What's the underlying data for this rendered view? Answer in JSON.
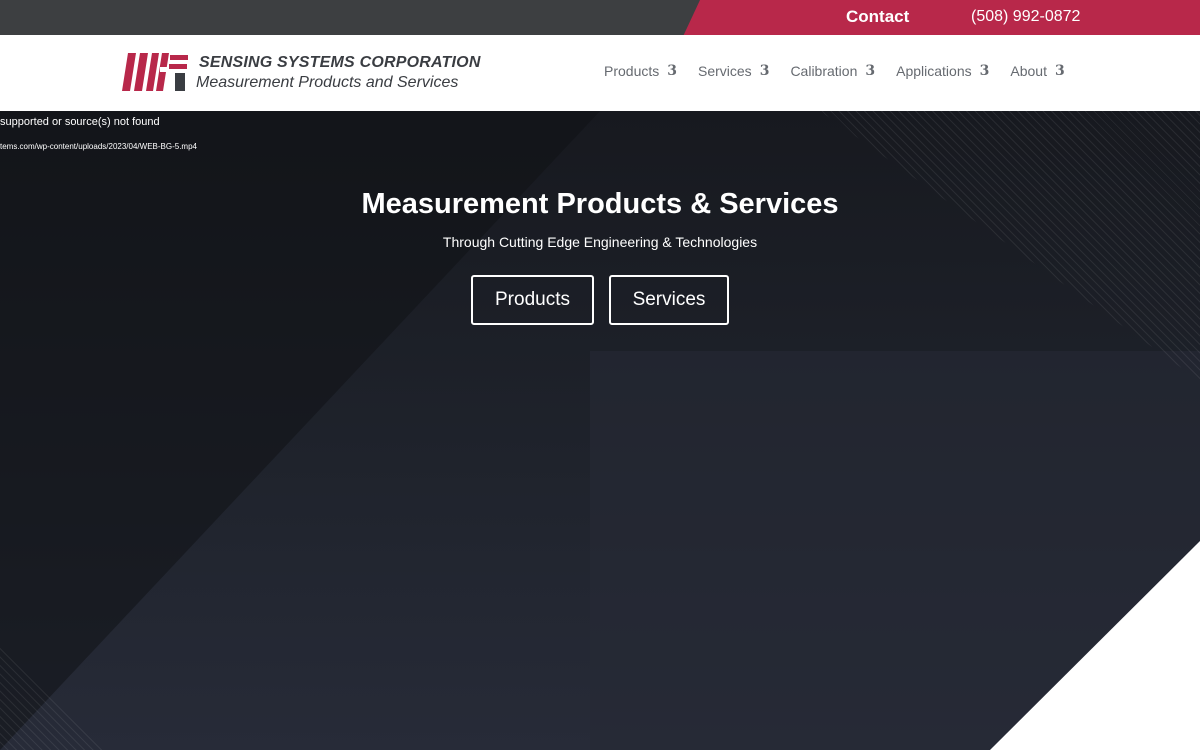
{
  "topbar": {
    "contact_label": "Contact",
    "phone": "(508) 992-0872",
    "accent_color": "#b8284a"
  },
  "header": {
    "brand_name": "SENSING SYSTEMS CORPORATION",
    "brand_tagline": "Measurement Products and Services",
    "logo_icon": "ssc-logo-icon",
    "nav": [
      {
        "label": "Products",
        "caret": "3"
      },
      {
        "label": "Services",
        "caret": "3"
      },
      {
        "label": "Calibration",
        "caret": "3"
      },
      {
        "label": "Applications",
        "caret": "3"
      },
      {
        "label": "About",
        "caret": "3"
      }
    ]
  },
  "hero": {
    "video_error": "supported or source(s) not found",
    "video_url": "tems.com/wp-content/uploads/2023/04/WEB-BG-5.mp4",
    "title": "Measurement Products & Services",
    "subtitle": "Through Cutting Edge Engineering & Technologies",
    "buttons": {
      "products": "Products",
      "services": "Services"
    }
  }
}
